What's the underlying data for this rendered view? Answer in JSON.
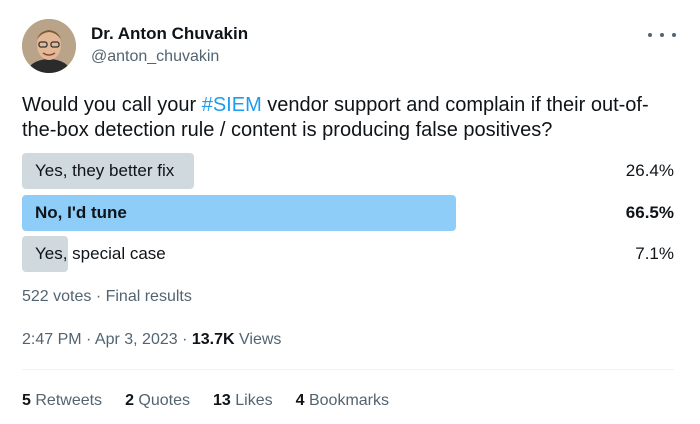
{
  "author": {
    "name": "Dr. Anton Chuvakin",
    "handle": "@anton_chuvakin",
    "avatar_icon": "profile-photo",
    "more_icon": "more-horizontal-icon"
  },
  "tweet": {
    "text_before": "Would you call your ",
    "hashtag": "#SIEM",
    "text_after": " vendor support and complain if their out-of-the-box detection rule / content is producing false positives?"
  },
  "poll": {
    "options": [
      {
        "label": "Yes, they better fix",
        "percent": "26.4%",
        "fraction": 0.264
      },
      {
        "label": "No, I'd tune",
        "percent": "66.5%",
        "fraction": 0.665,
        "winner": true
      },
      {
        "label": "Yes, special case",
        "percent": "7.1%",
        "fraction": 0.071
      }
    ],
    "summary": "522 votes · Final results"
  },
  "timestamp": {
    "time_date": "2:47 PM · Apr 3, 2023 · ",
    "views_count": "13.7K",
    "views_label": " Views"
  },
  "stats": [
    {
      "count": "5",
      "label": "Retweets"
    },
    {
      "count": "2",
      "label": "Quotes"
    },
    {
      "count": "13",
      "label": "Likes"
    },
    {
      "count": "4",
      "label": "Bookmarks"
    }
  ],
  "colors": {
    "bar": "#cfd9de",
    "winner_bar": "#8ecdf8",
    "hashtag": "#1d9bf0",
    "muted": "#536471"
  }
}
